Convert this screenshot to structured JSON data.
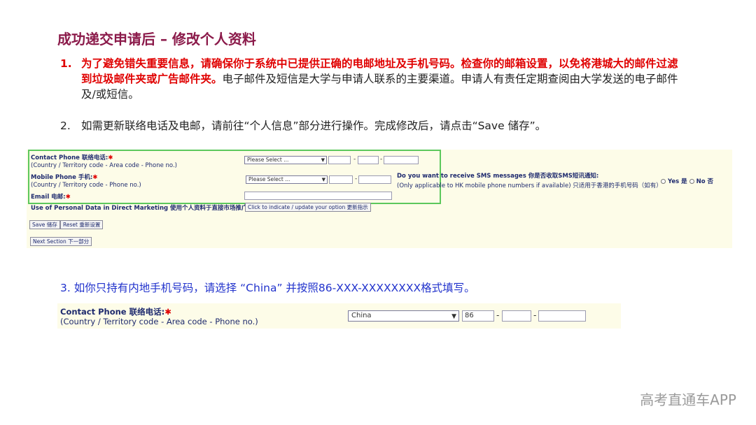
{
  "title": "成功递交申请后 – 修改个人资料",
  "step1": {
    "num": "1.",
    "red_text": "为了避免错失重要信息，请确保你于系统中已提供正确的电邮地址及手机号码。检查你的邮箱设置，以免将港城大的邮件过滤到垃圾邮件夹或广告邮件夹。",
    "text": "电子邮件及短信是大学与申请人联系的主要渠道。申请人有责任定期查阅由大学发送的电子邮件及/或短信。"
  },
  "step2": {
    "num": "2.",
    "text": "如需更新联络电话及电邮，请前往“个人信息”部分进行操作。完成修改后，请点击“Save 储存”。"
  },
  "form1": {
    "contact_label": "Contact Phone 联络电话:",
    "contact_sub": "(Country / Territory code - Area code - Phone no.)",
    "mobile_label": "Mobile Phone 手机:",
    "mobile_sub": "(Country / Territory code - Phone no.)",
    "email_label": "Email 电邮:",
    "required_mark": "✱",
    "select_placeholder": "Please Select ...",
    "dash": "-",
    "sms_question": "Do you want to receive SMS messages 你是否收取SMS短讯通知:",
    "sms_note": "(Only applicable to HK mobile phone numbers if available) 只适用于香港的手机号码（如有）",
    "yes_label": "Yes 是",
    "no_label": "No 否",
    "direct_marketing_label": "Use of Personal Data in Direct Marketing 使用个人资料于直接市场推广:",
    "direct_marketing_button": "Click to indicate / update your option 更新指示",
    "save_button": "Save 储存",
    "reset_button": "Reset 重新设置",
    "next_button": "Next Section 下一部分"
  },
  "step3": {
    "text": "3. 如你只持有内地手机号码，请选择 “China” 并按照86-XXX-XXXXXXXX格式填写。"
  },
  "form2": {
    "contact_label": "Contact Phone 联络电话:",
    "required_mark": "✱",
    "contact_sub": "(Country / Territory code - Area code - Phone no.)",
    "country_value": "China",
    "code_value": "86",
    "dash": "-"
  },
  "watermark": "高考直通车APP"
}
